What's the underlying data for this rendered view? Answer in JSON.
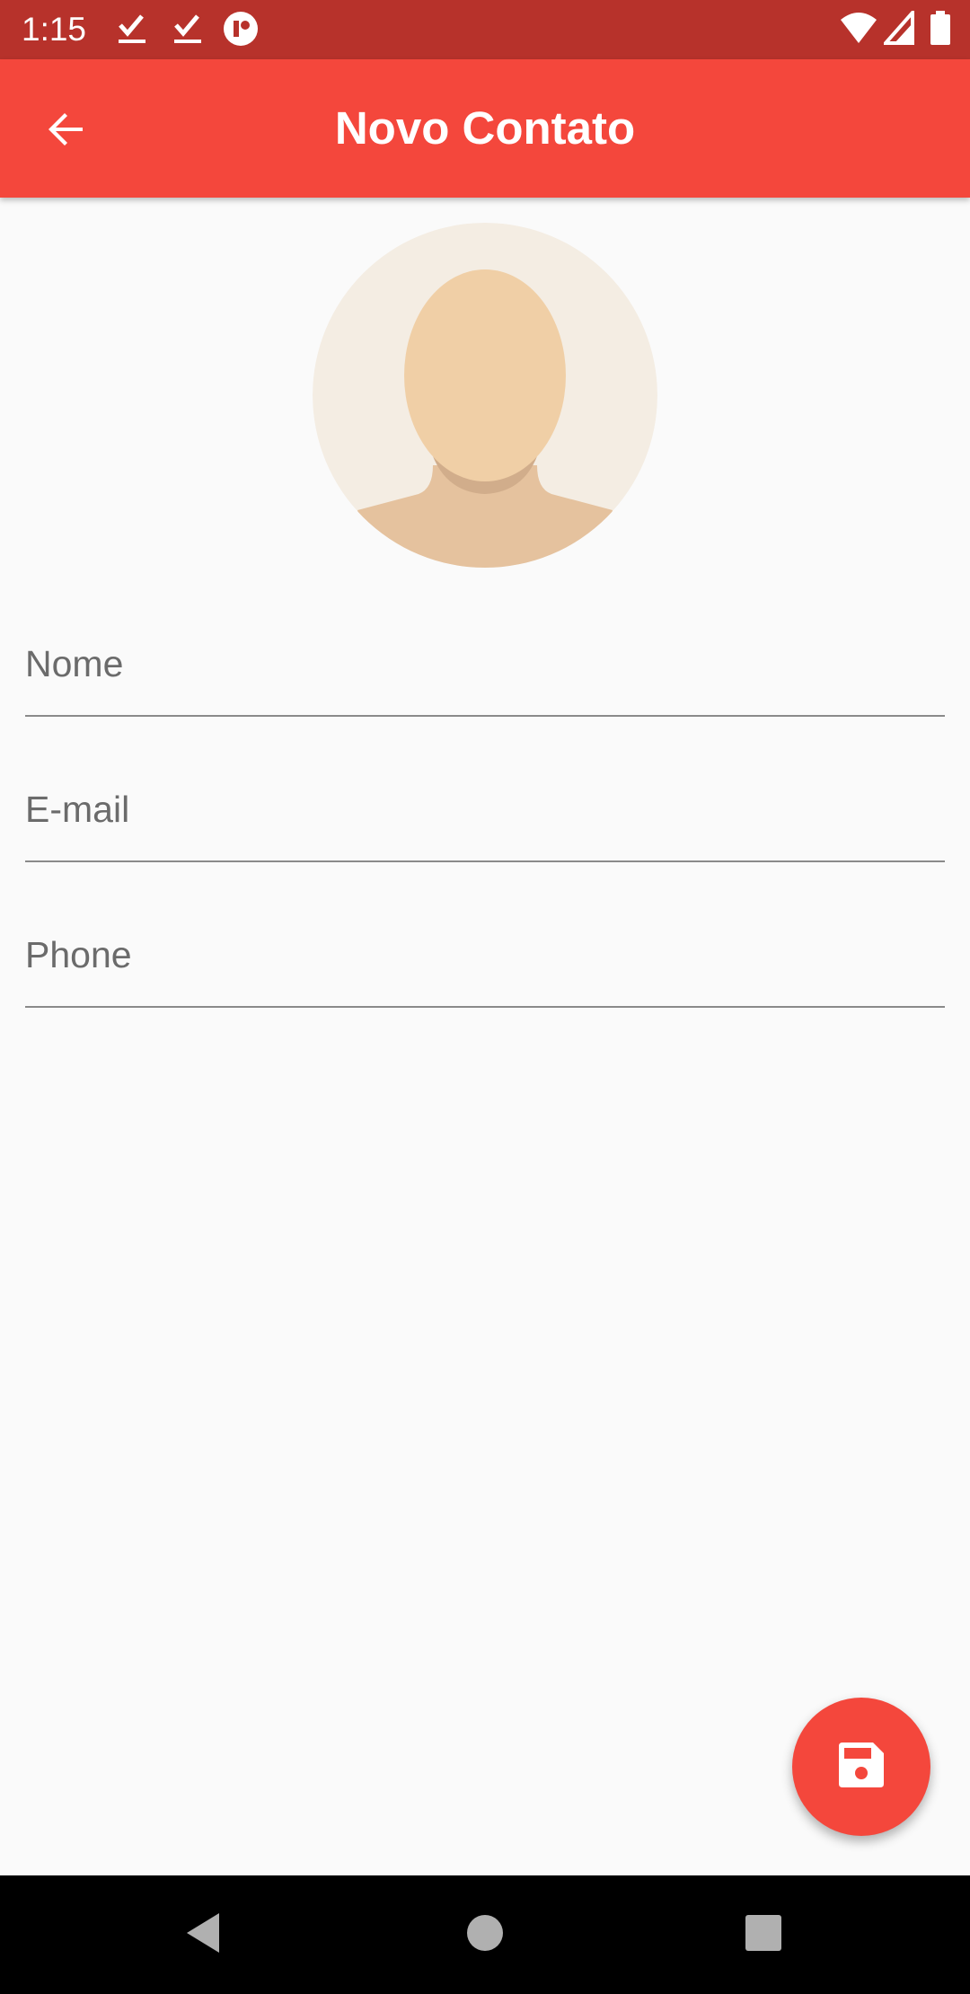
{
  "status_bar": {
    "time": "1:15",
    "icons_left": [
      "check-download-icon",
      "check-download-icon",
      "app-notification-icon"
    ],
    "icons_right": [
      "wifi-icon",
      "signal-icon",
      "battery-icon"
    ]
  },
  "app_bar": {
    "title": "Novo Contato",
    "back_icon": "arrow-back-icon",
    "color": "#f4473c"
  },
  "avatar": {
    "icon": "default-person-avatar"
  },
  "form": {
    "name_label": "Nome",
    "email_label": "E-mail",
    "phone_label": "Phone"
  },
  "fab": {
    "icon": "save-icon",
    "color": "#f4473c"
  },
  "nav_bar": {
    "buttons": [
      "back-triangle-icon",
      "home-circle-icon",
      "recents-square-icon"
    ]
  }
}
